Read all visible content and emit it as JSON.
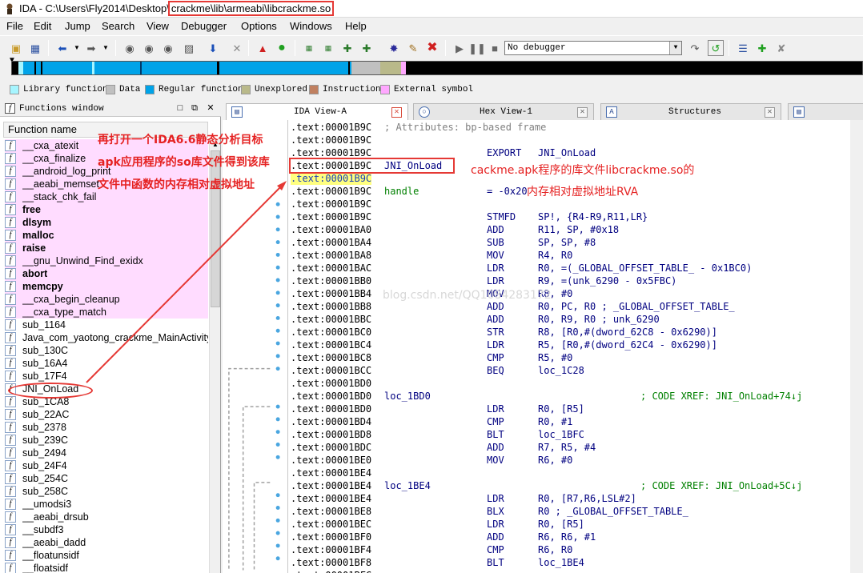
{
  "window": {
    "title_prefix": "IDA - C:\\Users\\Fly2014\\Desktop\\",
    "title_path": "crackme\\lib\\armeabi\\libcrackme.so"
  },
  "menu": [
    "File",
    "Edit",
    "Jump",
    "Search",
    "View",
    "Debugger",
    "Options",
    "Windows",
    "Help"
  ],
  "toolbar": {
    "debugger_value": "No debugger"
  },
  "legend": [
    {
      "label": "Library function",
      "color": "#a6f5ff"
    },
    {
      "label": "Data",
      "color": "#c0c0c0"
    },
    {
      "label": "Regular function",
      "color": "#00a3e8"
    },
    {
      "label": "Unexplored",
      "color": "#b9b98a"
    },
    {
      "label": "Instruction",
      "color": "#c08060"
    },
    {
      "label": "External symbol",
      "color": "#ffa8ff"
    }
  ],
  "functions_window": {
    "title": "Functions window",
    "column_header": "Function name",
    "items": [
      {
        "name": "__cxa_atexit",
        "bg": "#ffdcff",
        "bold": false
      },
      {
        "name": "__cxa_finalize",
        "bg": "#ffdcff",
        "bold": false
      },
      {
        "name": "__android_log_print",
        "bg": "#ffdcff",
        "bold": false
      },
      {
        "name": "__aeabi_memset",
        "bg": "#ffdcff",
        "bold": false
      },
      {
        "name": "__stack_chk_fail",
        "bg": "#ffdcff",
        "bold": false
      },
      {
        "name": "free",
        "bg": "#ffdcff",
        "bold": true
      },
      {
        "name": "dlsym",
        "bg": "#ffdcff",
        "bold": true
      },
      {
        "name": "malloc",
        "bg": "#ffdcff",
        "bold": true
      },
      {
        "name": "raise",
        "bg": "#ffdcff",
        "bold": true
      },
      {
        "name": "__gnu_Unwind_Find_exidx",
        "bg": "#ffdcff",
        "bold": false
      },
      {
        "name": "abort",
        "bg": "#ffdcff",
        "bold": true
      },
      {
        "name": "memcpy",
        "bg": "#ffdcff",
        "bold": true
      },
      {
        "name": "__cxa_begin_cleanup",
        "bg": "#ffdcff",
        "bold": false
      },
      {
        "name": "__cxa_type_match",
        "bg": "#ffdcff",
        "bold": false
      },
      {
        "name": "sub_1164",
        "bg": "#ffffff",
        "bold": false
      },
      {
        "name": "Java_com_yaotong_crackme_MainActivity",
        "bg": "#ffffff",
        "bold": false
      },
      {
        "name": "sub_130C",
        "bg": "#ffffff",
        "bold": false
      },
      {
        "name": "sub_16A4",
        "bg": "#ffffff",
        "bold": false
      },
      {
        "name": "sub_17F4",
        "bg": "#ffffff",
        "bold": false
      },
      {
        "name": "JNI_OnLoad",
        "bg": "#ffffff",
        "bold": false
      },
      {
        "name": "sub_1CA8",
        "bg": "#ffffff",
        "bold": false
      },
      {
        "name": "sub_22AC",
        "bg": "#ffffff",
        "bold": false
      },
      {
        "name": "sub_2378",
        "bg": "#ffffff",
        "bold": false
      },
      {
        "name": "sub_239C",
        "bg": "#ffffff",
        "bold": false
      },
      {
        "name": "sub_2494",
        "bg": "#ffffff",
        "bold": false
      },
      {
        "name": "sub_24F4",
        "bg": "#ffffff",
        "bold": false
      },
      {
        "name": "sub_254C",
        "bg": "#ffffff",
        "bold": false
      },
      {
        "name": "sub_258C",
        "bg": "#ffffff",
        "bold": false
      },
      {
        "name": "__umodsi3",
        "bg": "#ffffff",
        "bold": false
      },
      {
        "name": "__aeabi_drsub",
        "bg": "#ffffff",
        "bold": false
      },
      {
        "name": "__subdf3",
        "bg": "#ffffff",
        "bold": false
      },
      {
        "name": "__aeabi_dadd",
        "bg": "#ffffff",
        "bold": false
      },
      {
        "name": "__floatunsidf",
        "bg": "#ffffff",
        "bold": false
      },
      {
        "name": "__floatsidf",
        "bg": "#ffffff",
        "bold": false
      }
    ]
  },
  "tabs": [
    {
      "label": "IDA View-A",
      "active": true
    },
    {
      "label": "Hex View-1",
      "active": false
    },
    {
      "label": "Structures",
      "active": false
    }
  ],
  "code": [
    {
      "addr": ".text:00001B9C",
      "label": "; Attributes: bp-based frame",
      "mnem": "",
      "ops": "",
      "style": "comment"
    },
    {
      "addr": ".text:00001B9C",
      "label": "",
      "mnem": "",
      "ops": "",
      "style": ""
    },
    {
      "addr": ".text:00001B9C",
      "label": "",
      "mnem": "EXPORT",
      "ops": "JNI_OnLoad",
      "style": ""
    },
    {
      "addr": ".text:00001B9C",
      "label": "JNI_OnLoad",
      "mnem": "",
      "ops": "",
      "style": ""
    },
    {
      "addr": ".text:00001B9C",
      "label": "",
      "mnem": "",
      "ops": "",
      "style": "cur"
    },
    {
      "addr": ".text:00001B9C",
      "label": "handle",
      "mnem": "= -0x20",
      "ops": "",
      "style": "handle"
    },
    {
      "addr": ".text:00001B9C",
      "label": "",
      "mnem": "",
      "ops": "",
      "style": ""
    },
    {
      "addr": ".text:00001B9C",
      "label": "",
      "mnem": "STMFD",
      "ops": "SP!, {R4-R9,R11,LR}",
      "style": ""
    },
    {
      "addr": ".text:00001BA0",
      "label": "",
      "mnem": "ADD",
      "ops": "R11, SP, #0x18",
      "style": ""
    },
    {
      "addr": ".text:00001BA4",
      "label": "",
      "mnem": "SUB",
      "ops": "SP, SP, #8",
      "style": ""
    },
    {
      "addr": ".text:00001BA8",
      "label": "",
      "mnem": "MOV",
      "ops": "R4, R0",
      "style": ""
    },
    {
      "addr": ".text:00001BAC",
      "label": "",
      "mnem": "LDR",
      "ops": "R0, =(_GLOBAL_OFFSET_TABLE_ - 0x1BC0)",
      "style": ""
    },
    {
      "addr": ".text:00001BB0",
      "label": "",
      "mnem": "LDR",
      "ops": "R9, =(unk_6290 - 0x5FBC)",
      "style": ""
    },
    {
      "addr": ".text:00001BB4",
      "label": "",
      "mnem": "MOV",
      "ops": "R8, #0",
      "style": ""
    },
    {
      "addr": ".text:00001BB8",
      "label": "",
      "mnem": "ADD",
      "ops": "R0, PC, R0 ; _GLOBAL_OFFSET_TABLE_",
      "style": ""
    },
    {
      "addr": ".text:00001BBC",
      "label": "",
      "mnem": "ADD",
      "ops": "R0, R9, R0 ; unk_6290",
      "style": ""
    },
    {
      "addr": ".text:00001BC0",
      "label": "",
      "mnem": "STR",
      "ops": "R8, [R0,#(dword_62C8 - 0x6290)]",
      "style": ""
    },
    {
      "addr": ".text:00001BC4",
      "label": "",
      "mnem": "LDR",
      "ops": "R5, [R0,#(dword_62C4 - 0x6290)]",
      "style": ""
    },
    {
      "addr": ".text:00001BC8",
      "label": "",
      "mnem": "CMP",
      "ops": "R5, #0",
      "style": ""
    },
    {
      "addr": ".text:00001BCC",
      "label": "",
      "mnem": "BEQ",
      "ops": "loc_1C28",
      "style": ""
    },
    {
      "addr": ".text:00001BD0",
      "label": "",
      "mnem": "",
      "ops": "",
      "style": ""
    },
    {
      "addr": ".text:00001BD0",
      "label": "loc_1BD0",
      "mnem": "",
      "ops": "",
      "xref": "; CODE XREF: JNI_OnLoad+74↓j",
      "style": ""
    },
    {
      "addr": ".text:00001BD0",
      "label": "",
      "mnem": "LDR",
      "ops": "R0, [R5]",
      "style": ""
    },
    {
      "addr": ".text:00001BD4",
      "label": "",
      "mnem": "CMP",
      "ops": "R0, #1",
      "style": ""
    },
    {
      "addr": ".text:00001BD8",
      "label": "",
      "mnem": "BLT",
      "ops": "loc_1BFC",
      "style": ""
    },
    {
      "addr": ".text:00001BDC",
      "label": "",
      "mnem": "ADD",
      "ops": "R7, R5, #4",
      "style": ""
    },
    {
      "addr": ".text:00001BE0",
      "label": "",
      "mnem": "MOV",
      "ops": "R6, #0",
      "style": ""
    },
    {
      "addr": ".text:00001BE4",
      "label": "",
      "mnem": "",
      "ops": "",
      "style": ""
    },
    {
      "addr": ".text:00001BE4",
      "label": "loc_1BE4",
      "mnem": "",
      "ops": "",
      "xref": "; CODE XREF: JNI_OnLoad+5C↓j",
      "style": ""
    },
    {
      "addr": ".text:00001BE4",
      "label": "",
      "mnem": "LDR",
      "ops": "R0, [R7,R6,LSL#2]",
      "style": ""
    },
    {
      "addr": ".text:00001BE8",
      "label": "",
      "mnem": "BLX",
      "ops": "R0 ; _GLOBAL_OFFSET_TABLE_",
      "style": ""
    },
    {
      "addr": ".text:00001BEC",
      "label": "",
      "mnem": "LDR",
      "ops": "R0, [R5]",
      "style": ""
    },
    {
      "addr": ".text:00001BF0",
      "label": "",
      "mnem": "ADD",
      "ops": "R6, R6, #1",
      "style": ""
    },
    {
      "addr": ".text:00001BF4",
      "label": "",
      "mnem": "CMP",
      "ops": "R6, R0",
      "style": ""
    },
    {
      "addr": ".text:00001BF8",
      "label": "",
      "mnem": "BLT",
      "ops": "loc_1BE4",
      "style": ""
    },
    {
      "addr": ".text:00001BFC",
      "label": "",
      "mnem": "",
      "ops": "",
      "style": ""
    }
  ],
  "annotations": {
    "left_line1": "再打开一个IDA6.6静态分析目标",
    "left_line2": "apk应用程序的so库文件得到该库",
    "left_line3": "文件中函数的内存相对虚拟地址",
    "right_line1": "cackme.apk程序的库文件libcrackme.so的",
    "right_line2": "内存相对虚拟地址RVA"
  },
  "watermark": "blog.csdn.net/QQ1084283172"
}
